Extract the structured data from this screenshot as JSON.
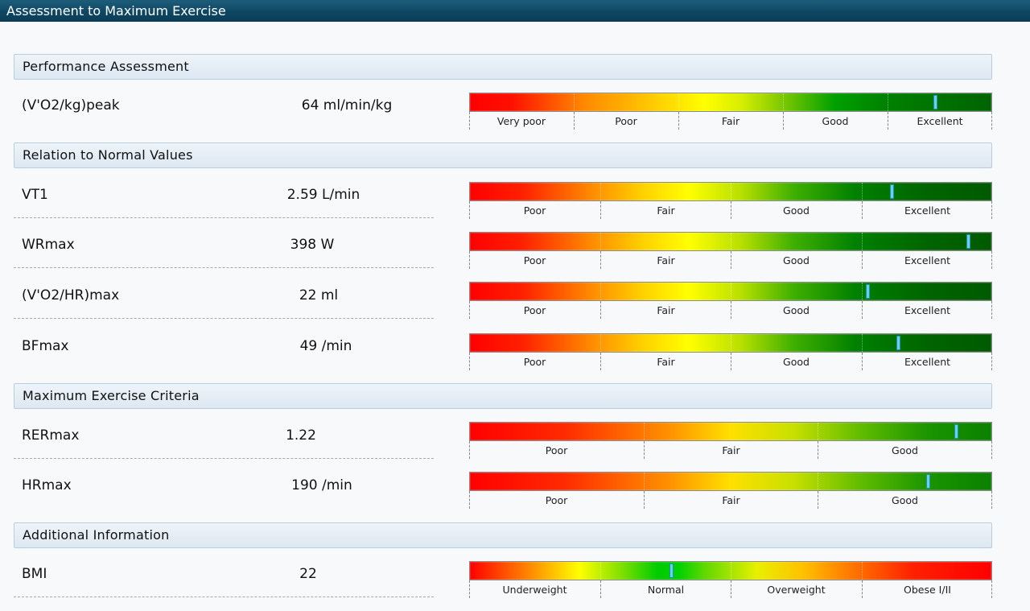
{
  "window": {
    "title": "Assessment to Maximum Exercise"
  },
  "sections": {
    "performance": "Performance Assessment",
    "relation": "Relation to Normal Values",
    "criteria": "Maximum Exercise Criteria",
    "additional": "Additional Information"
  },
  "scales": {
    "five": [
      "Very poor",
      "Poor",
      "Fair",
      "Good",
      "Excellent"
    ],
    "four": [
      "Poor",
      "Fair",
      "Good",
      "Excellent"
    ],
    "three": [
      "Poor",
      "Fair",
      "Good"
    ],
    "bmi": [
      "Underweight",
      "Normal",
      "Overweight",
      "Obese I/II"
    ]
  },
  "rows": [
    {
      "label": "(V'O2/kg)peak",
      "value": "64 ml/min/kg",
      "scale": "five",
      "marker_fraction": 0.891
    },
    {
      "label": "VT1",
      "value": "2.59 L/min",
      "scale": "four",
      "marker_fraction": 0.808
    },
    {
      "label": "WRmax",
      "value": "398 W",
      "scale": "four",
      "marker_fraction": 0.955
    },
    {
      "label": "(V'O2/HR)max",
      "value": "22 ml",
      "scale": "four",
      "marker_fraction": 0.762
    },
    {
      "label": "BFmax",
      "value": "49 /min",
      "scale": "four",
      "marker_fraction": 0.82
    },
    {
      "label": "RERmax",
      "value": "1.22",
      "scale": "three",
      "marker_fraction": 0.932
    },
    {
      "label": "HRmax",
      "value": "190 /min",
      "scale": "three",
      "marker_fraction": 0.877
    },
    {
      "label": "BMI",
      "value": "22",
      "scale": "bmi",
      "marker_fraction": 0.387
    }
  ],
  "colors": {
    "title_bar": "#0f4763",
    "marker": "#62d3f2",
    "section_header": "#dde8f2"
  }
}
